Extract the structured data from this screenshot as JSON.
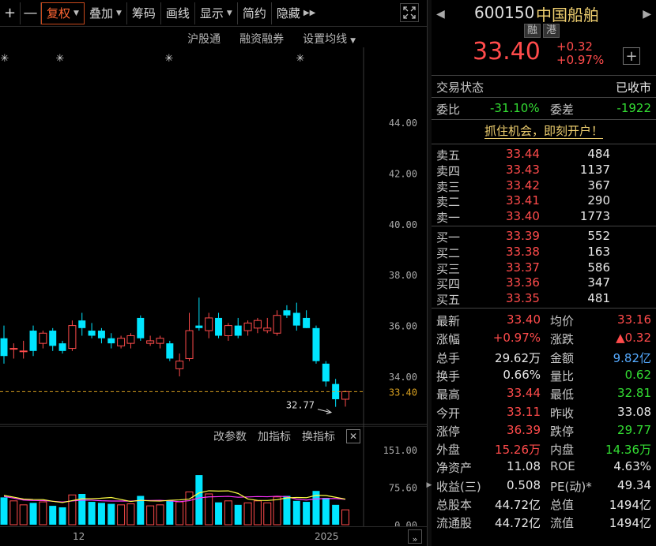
{
  "toolbar": {
    "plus": "+",
    "minus": "—",
    "fuquan": "复权",
    "diejia": "叠加",
    "chouma": "筹码",
    "huaxian": "画线",
    "xianshi": "显示",
    "jianyue": "简约",
    "yincang": "隐藏"
  },
  "subbar": {
    "hugutong": "沪股通",
    "rongzi": "融资融券",
    "junxian": "设置均线"
  },
  "volbar": {
    "gaicanshu": "改参数",
    "jiazhibiao": "加指标",
    "huanzhibiao": "换指标",
    "close": "✕"
  },
  "chart_data": {
    "type": "candlestick",
    "y_ticks": [
      "44.00",
      "42.00",
      "40.00",
      "38.00",
      "36.00",
      "34.00"
    ],
    "current_price": "33.40",
    "low_annotation": "32.77",
    "vol_ticks": [
      "151.00",
      "75.60",
      "0.00"
    ],
    "x_labels": [
      "12",
      "2025"
    ],
    "markers": 4,
    "candles": [
      {
        "o": 35.5,
        "h": 36.0,
        "l": 34.5,
        "c": 34.8
      },
      {
        "o": 35.1,
        "h": 35.3,
        "l": 34.7,
        "c": 35.1
      },
      {
        "o": 35.0,
        "h": 35.4,
        "l": 34.7,
        "c": 35.0
      },
      {
        "o": 35.8,
        "h": 36.0,
        "l": 34.8,
        "c": 35.0
      },
      {
        "o": 35.3,
        "h": 35.8,
        "l": 35.1,
        "c": 35.7
      },
      {
        "o": 35.8,
        "h": 35.9,
        "l": 35.0,
        "c": 35.2
      },
      {
        "o": 35.3,
        "h": 35.4,
        "l": 34.9,
        "c": 35.0
      },
      {
        "o": 35.1,
        "h": 36.2,
        "l": 35.0,
        "c": 36.0
      },
      {
        "o": 36.2,
        "h": 36.5,
        "l": 35.6,
        "c": 35.9
      },
      {
        "o": 35.8,
        "h": 36.1,
        "l": 35.5,
        "c": 35.6
      },
      {
        "o": 35.8,
        "h": 35.9,
        "l": 35.3,
        "c": 35.5
      },
      {
        "o": 35.5,
        "h": 35.7,
        "l": 35.1,
        "c": 35.3
      },
      {
        "o": 35.2,
        "h": 35.6,
        "l": 35.1,
        "c": 35.5
      },
      {
        "o": 35.3,
        "h": 35.7,
        "l": 35.1,
        "c": 35.6
      },
      {
        "o": 36.3,
        "h": 36.4,
        "l": 35.4,
        "c": 35.5
      },
      {
        "o": 35.3,
        "h": 35.6,
        "l": 35.2,
        "c": 35.4
      },
      {
        "o": 35.3,
        "h": 35.6,
        "l": 35.1,
        "c": 35.5
      },
      {
        "o": 35.3,
        "h": 35.4,
        "l": 34.6,
        "c": 34.7
      },
      {
        "o": 34.3,
        "h": 34.9,
        "l": 34.0,
        "c": 34.6
      },
      {
        "o": 34.7,
        "h": 36.5,
        "l": 34.6,
        "c": 35.8
      },
      {
        "o": 36.0,
        "h": 37.1,
        "l": 35.8,
        "c": 35.9
      },
      {
        "o": 35.8,
        "h": 36.5,
        "l": 35.5,
        "c": 36.3
      },
      {
        "o": 36.3,
        "h": 36.5,
        "l": 35.5,
        "c": 35.6
      },
      {
        "o": 35.6,
        "h": 36.1,
        "l": 35.4,
        "c": 36.0
      },
      {
        "o": 36.0,
        "h": 36.3,
        "l": 35.5,
        "c": 35.6
      },
      {
        "o": 35.8,
        "h": 36.2,
        "l": 35.6,
        "c": 36.1
      },
      {
        "o": 35.9,
        "h": 36.3,
        "l": 35.7,
        "c": 36.2
      },
      {
        "o": 35.8,
        "h": 36.3,
        "l": 35.7,
        "c": 35.9
      },
      {
        "o": 35.7,
        "h": 36.6,
        "l": 35.6,
        "c": 36.4
      },
      {
        "o": 36.6,
        "h": 36.8,
        "l": 36.3,
        "c": 36.4
      },
      {
        "o": 36.5,
        "h": 36.9,
        "l": 35.8,
        "c": 36.0
      },
      {
        "o": 36.3,
        "h": 36.6,
        "l": 35.9,
        "c": 35.9
      },
      {
        "o": 35.9,
        "h": 36.0,
        "l": 34.5,
        "c": 34.6
      },
      {
        "o": 34.5,
        "h": 34.6,
        "l": 33.6,
        "c": 33.8
      },
      {
        "o": 33.7,
        "h": 33.9,
        "l": 32.8,
        "c": 33.1
      },
      {
        "o": 33.1,
        "h": 33.44,
        "l": 32.81,
        "c": 33.4
      }
    ],
    "volumes": [
      55,
      48,
      40,
      44,
      46,
      38,
      35,
      60,
      62,
      46,
      44,
      42,
      40,
      42,
      58,
      38,
      40,
      48,
      46,
      66,
      100,
      62,
      45,
      48,
      40,
      44,
      48,
      44,
      56,
      58,
      48,
      46,
      68,
      54,
      40,
      30
    ]
  },
  "header": {
    "code": "600150",
    "name": "中国船舶",
    "tag_rong": "融",
    "tag_gang": "港",
    "price": "33.40",
    "change": "+0.32",
    "change_pct": "+0.97%",
    "plus": "+"
  },
  "status": {
    "label": "交易状态",
    "value": "已收市"
  },
  "weibi": {
    "label": "委比",
    "value": "-31.10%",
    "label2": "委差",
    "value2": "-1922"
  },
  "promo": "抓住机会，即刻开户！",
  "asks": [
    {
      "label": "卖五",
      "price": "33.44",
      "vol": "484"
    },
    {
      "label": "卖四",
      "price": "33.43",
      "vol": "1137"
    },
    {
      "label": "卖三",
      "price": "33.42",
      "vol": "367"
    },
    {
      "label": "卖二",
      "price": "33.41",
      "vol": "290"
    },
    {
      "label": "卖一",
      "price": "33.40",
      "vol": "1773"
    }
  ],
  "bids": [
    {
      "label": "买一",
      "price": "33.39",
      "vol": "552"
    },
    {
      "label": "买二",
      "price": "33.38",
      "vol": "163"
    },
    {
      "label": "买三",
      "price": "33.37",
      "vol": "586"
    },
    {
      "label": "买四",
      "price": "33.36",
      "vol": "347"
    },
    {
      "label": "买五",
      "price": "33.35",
      "vol": "481"
    }
  ],
  "stats": [
    {
      "l1": "最新",
      "v1": "33.40",
      "c1": "red",
      "l2": "均价",
      "v2": "33.16",
      "c2": "red"
    },
    {
      "l1": "涨幅",
      "v1": "+0.97%",
      "c1": "red",
      "l2": "涨跌",
      "v2": "▲0.32",
      "c2": "red"
    },
    {
      "l1": "总手",
      "v1": "29.62万",
      "c1": "white",
      "l2": "金额",
      "v2": "9.82亿",
      "c2": "blue"
    },
    {
      "l1": "换手",
      "v1": "0.66%",
      "c1": "white",
      "l2": "量比",
      "v2": "0.62",
      "c2": "green"
    },
    {
      "l1": "最高",
      "v1": "33.44",
      "c1": "red",
      "l2": "最低",
      "v2": "32.81",
      "c2": "green"
    },
    {
      "l1": "今开",
      "v1": "33.11",
      "c1": "red",
      "l2": "昨收",
      "v2": "33.08",
      "c2": "white"
    },
    {
      "l1": "涨停",
      "v1": "36.39",
      "c1": "red",
      "l2": "跌停",
      "v2": "29.77",
      "c2": "green"
    },
    {
      "l1": "外盘",
      "v1": "15.26万",
      "c1": "red",
      "l2": "内盘",
      "v2": "14.36万",
      "c2": "green"
    },
    {
      "l1": "净资产",
      "v1": "11.08",
      "c1": "white",
      "l2": "ROE",
      "v2": "4.63%",
      "c2": "white"
    },
    {
      "l1": "收益(三)",
      "v1": "0.508",
      "c1": "white",
      "l2": "PE(动)*",
      "v2": "49.34",
      "c2": "white"
    },
    {
      "l1": "总股本",
      "v1": "44.72亿",
      "c1": "white",
      "l2": "总值",
      "v2": "1494亿",
      "c2": "white"
    },
    {
      "l1": "流通股",
      "v1": "44.72亿",
      "c1": "white",
      "l2": "流值",
      "v2": "1494亿",
      "c2": "white"
    }
  ],
  "colors": {
    "up": "#ff4b4b",
    "down": "#00e5ff",
    "ma1": "#ff33ff",
    "ma2": "#ffff44",
    "dash": "#d8a020"
  }
}
